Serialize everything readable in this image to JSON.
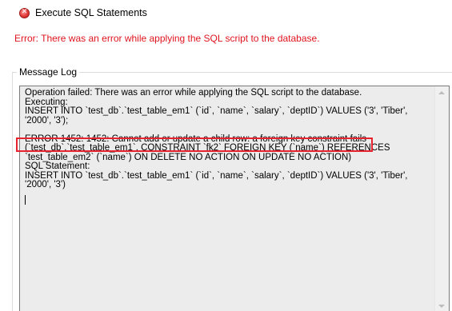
{
  "step": {
    "icon": "error-circle-icon",
    "label": "Execute SQL Statements"
  },
  "error_message": "Error: There was an error while applying the SQL script to the database.",
  "message_log": {
    "title": "Message Log",
    "lines": [
      "Operation failed: There was an error while applying the SQL script to the database.",
      "Executing:",
      "INSERT INTO `test_db`.`test_table_em1` (`id`, `name`, `salary`, `deptID`) VALUES ('3', 'Tiber',",
      "'2000', '3');",
      "",
      "ERROR 1452: 1452: Cannot add or update a child row: a foreign key constraint fails",
      "(`test_db`.`test_table_em1`, CONSTRAINT `fk2` FOREIGN KEY (`name`) REFERENCES",
      "`test_table_em2` (`name`) ON DELETE NO ACTION ON UPDATE NO ACTION)",
      "SQL Statement:",
      "INSERT INTO `test_db`.`test_table_em1` (`id`, `name`, `salary`, `deptID`) VALUES ('3', 'Tiber',",
      "'2000', '3')"
    ]
  },
  "colors": {
    "error_text": "#e0141e",
    "highlight": "#e8232d",
    "log_background": "#ececec"
  }
}
